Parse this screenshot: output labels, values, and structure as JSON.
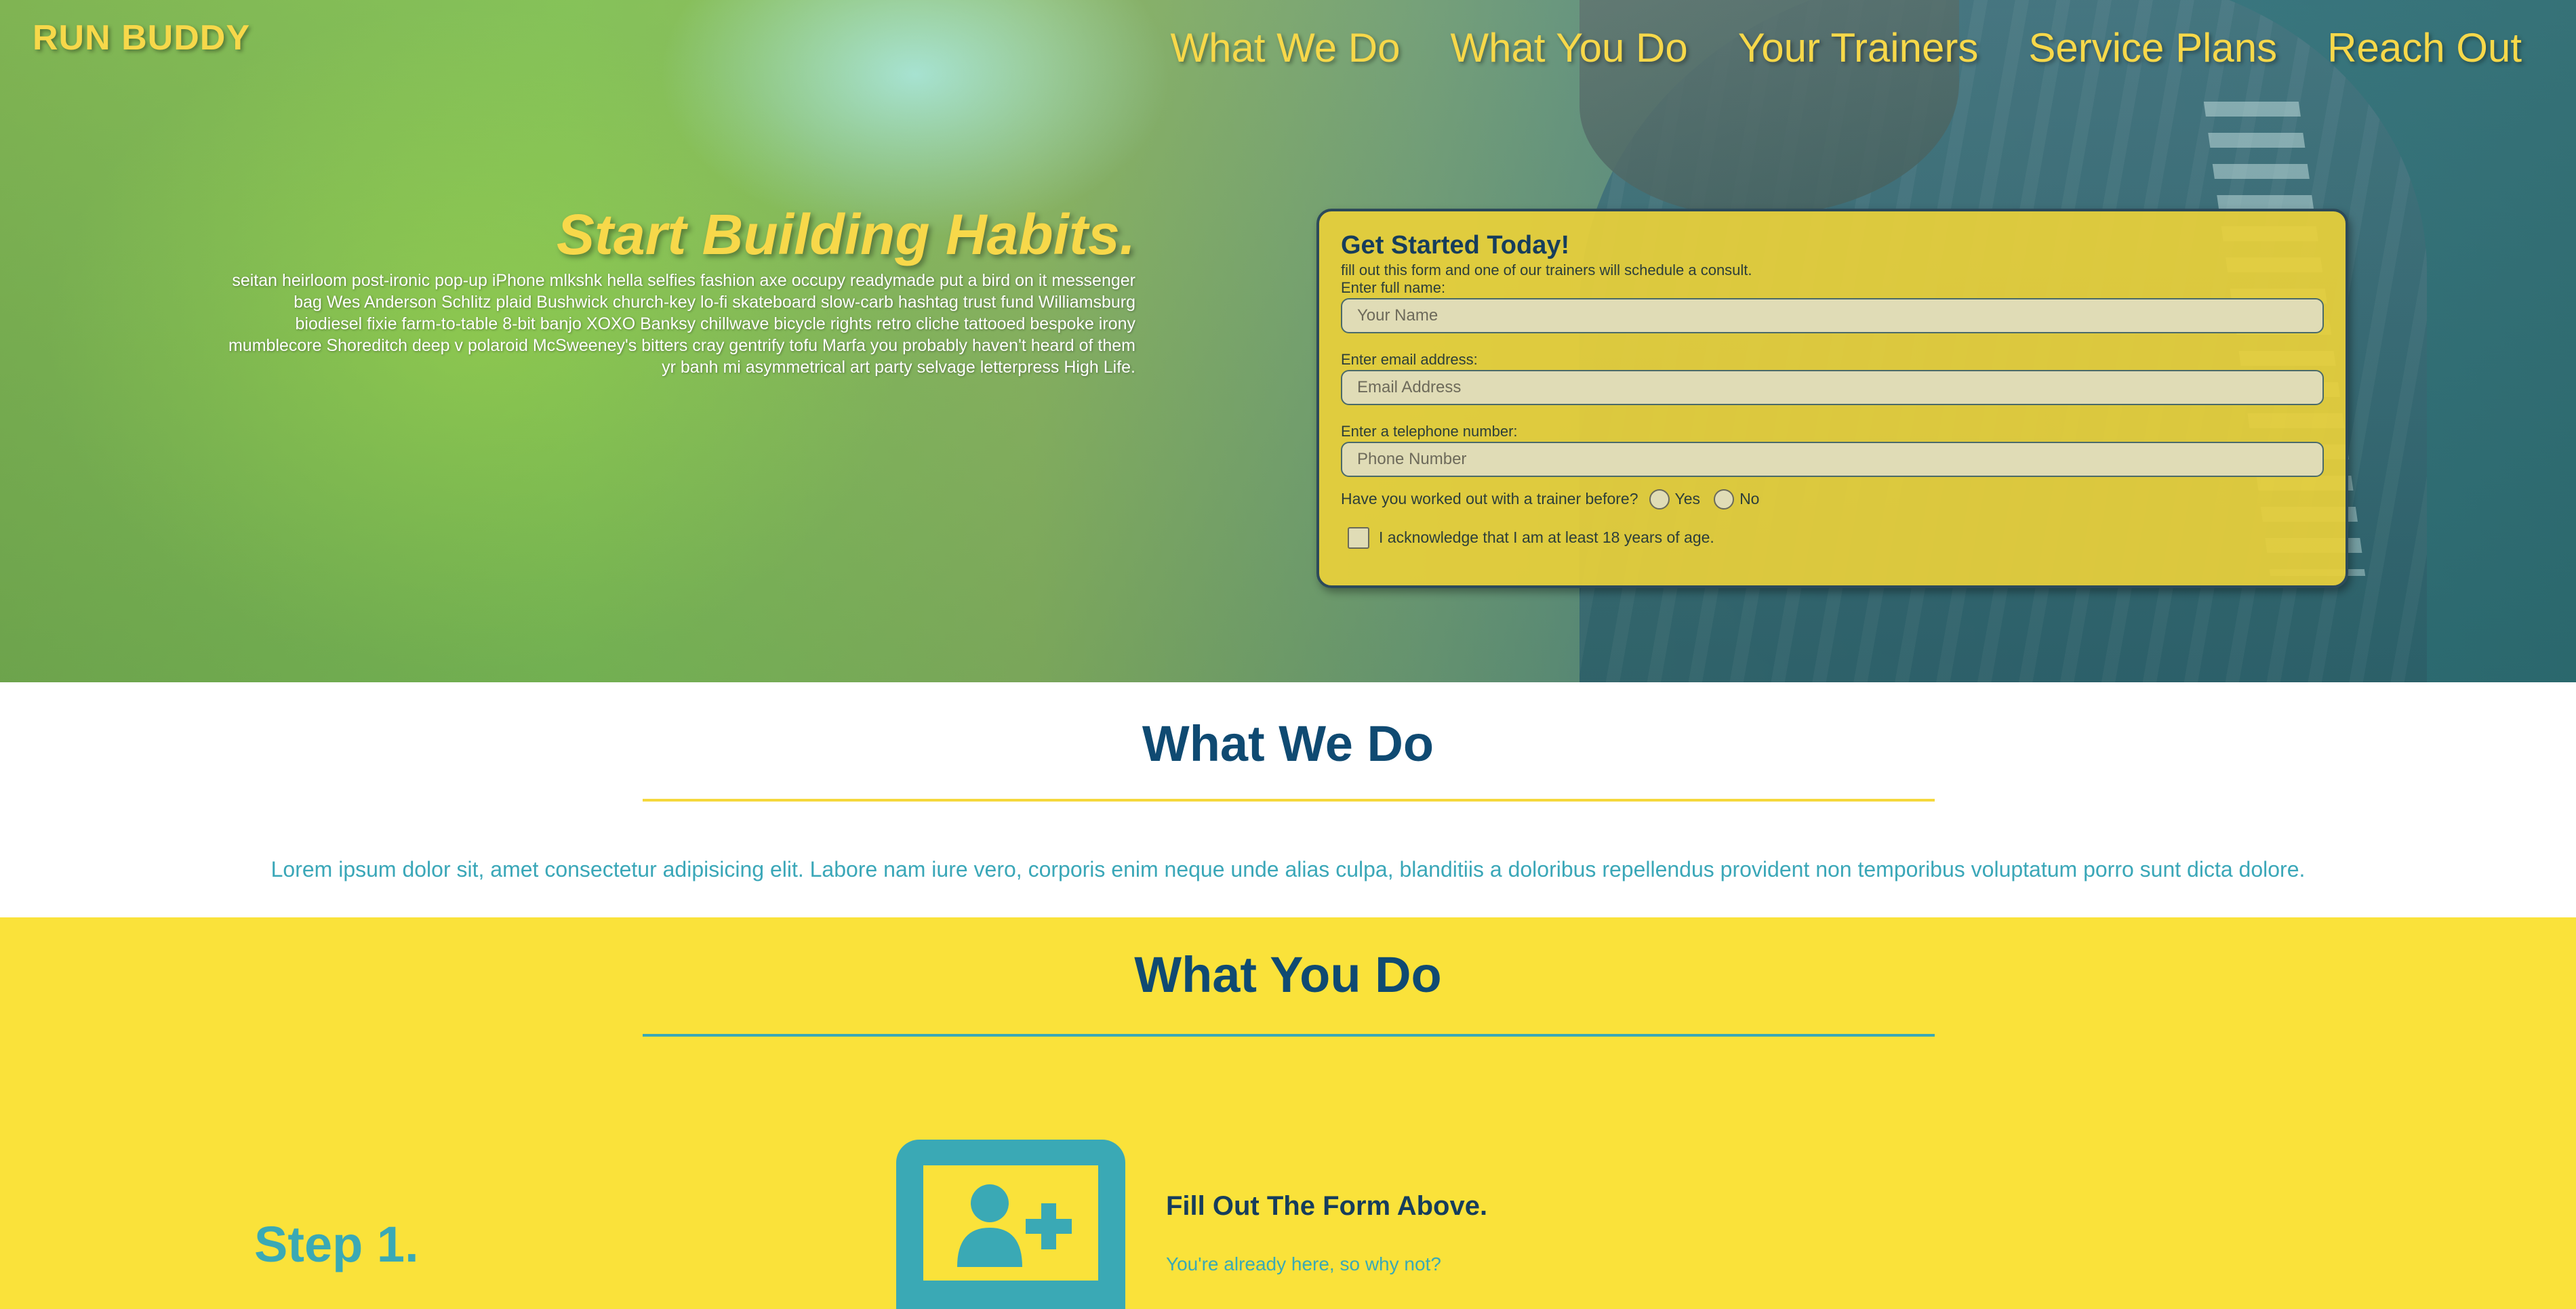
{
  "brand": "RUN BUDDY",
  "nav": [
    "What We Do",
    "What You Do",
    "Your Trainers",
    "Service Plans",
    "Reach Out"
  ],
  "hero": {
    "title": "Start Building Habits.",
    "text": "seitan heirloom post-ironic pop-up iPhone mlkshk hella selfies fashion axe occupy readymade put a bird on it messenger bag Wes Anderson Schlitz plaid Bushwick church-key lo-fi skateboard slow-carb hashtag trust fund Williamsburg biodiesel fixie farm-to-table 8-bit banjo XOXO Banksy chillwave bicycle rights retro cliche tattooed bespoke irony mumblecore Shoreditch deep v polaroid McSweeney's bitters cray gentrify tofu Marfa you probably haven't heard of them yr banh mi asymmetrical art party selvage letterpress High Life."
  },
  "form": {
    "title": "Get Started Today!",
    "subtitle": "fill out this form and one of our trainers will schedule a consult.",
    "name_label": "Enter full name:",
    "name_placeholder": "Your Name",
    "email_label": "Enter email address:",
    "email_placeholder": "Email Address",
    "phone_label": "Enter a telephone number:",
    "phone_placeholder": "Phone Number",
    "trainer_question": "Have you worked out with a trainer before?",
    "yes_label": "Yes",
    "no_label": "No",
    "age_ack": "I acknowledge that I am at least 18 years of age."
  },
  "what_we_do": {
    "title": "What We Do",
    "text": "Lorem ipsum dolor sit, amet consectetur adipisicing elit. Labore nam iure vero, corporis enim neque unde alias culpa, blanditiis a doloribus repellendus provident non temporibus voluptatum porro sunt dicta dolore."
  },
  "what_you_do": {
    "title": "What You Do",
    "step_label": "Step 1.",
    "step_heading": "Fill Out The Form Above.",
    "step_sub": "You're already here, so why not?"
  },
  "colors": {
    "accent_yellow": "#f7d84a",
    "section_yellow": "#fae23a",
    "navy": "#0f4a72",
    "teal": "#3aa9b5"
  },
  "icons": {
    "step1": "add-user-icon"
  }
}
